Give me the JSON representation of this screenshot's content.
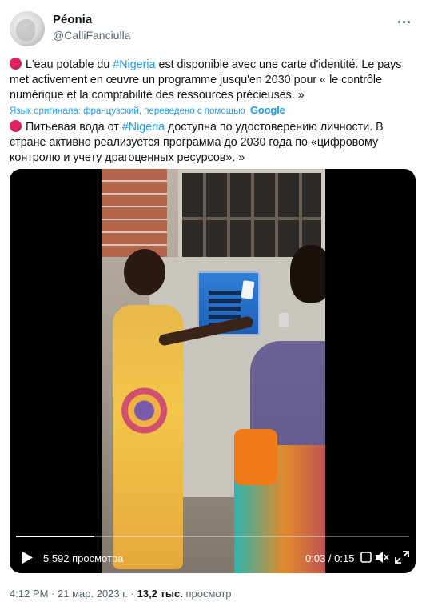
{
  "author": {
    "name": "Péonia",
    "handle": "@CalliFanciulla"
  },
  "tweet": {
    "original_before": "L'eau potable du ",
    "hashtag": "#Nigeria",
    "original_after": " est disponible avec une carte d'identité. Le pays met activement en œuvre un programme jusqu'en 2030 pour « le contrôle numérique et la comptabilité des ressources précieuses. »",
    "translation_note": "Язык оригинала: французский, переведено с помощью",
    "translation_provider": "Google",
    "translated_before": "Питьевая вода от ",
    "translated_after": " доступна по удостоверению личности. В стране активно реализуется программа до 2030 года по «цифровому контролю и учету драгоценных ресурсов». »"
  },
  "video": {
    "views_label": "5 592 просмотра",
    "time_label": "0:03 / 0:15",
    "progress_fraction": 0.2
  },
  "footer": {
    "time": "4:12 PM",
    "separator": "·",
    "date": "21 мар. 2023 г.",
    "views_count": "13,2 тыс.",
    "views_label": "просмотр"
  },
  "colors": {
    "accent": "#1d9bf0",
    "emoji_red": "#e0245e",
    "muted_text": "#536471"
  },
  "icons": [
    "more-icon",
    "red-circle-emoji",
    "play-icon",
    "gif-icon",
    "mute-icon",
    "expand-icon"
  ]
}
